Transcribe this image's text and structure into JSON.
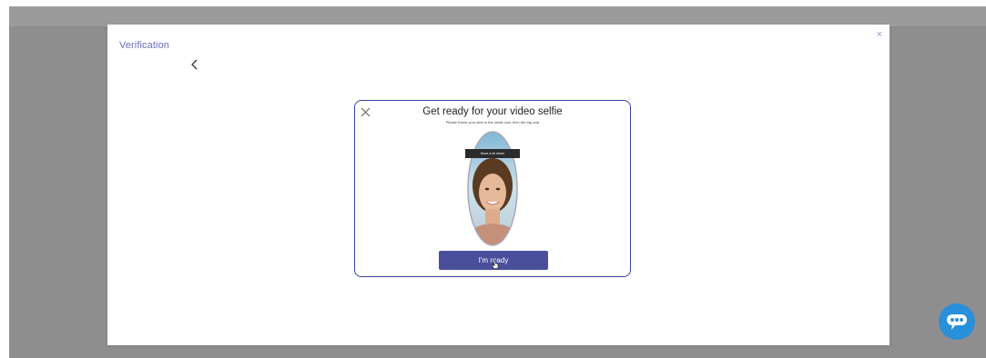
{
  "modal": {
    "title": "Verification",
    "close_glyph": "×"
  },
  "selfie_card": {
    "title": "Get ready for your video selfie",
    "subtitle": "Please frame your face in the small oval, then the big oval",
    "oval_label": "Move a bit closer",
    "ready_button": "I'm ready"
  },
  "icons": {
    "modal_close": "close-icon",
    "back": "chevron-left-icon",
    "card_close": "close-icon",
    "chat": "chat-icon",
    "cursor": "hand-pointer-icon"
  },
  "colors": {
    "accent": "#4a4f9c",
    "card_border": "#3c429c",
    "title_text": "#6a6ec4",
    "chat_button": "#2a8fd9",
    "backdrop": "#8e8e8e"
  }
}
